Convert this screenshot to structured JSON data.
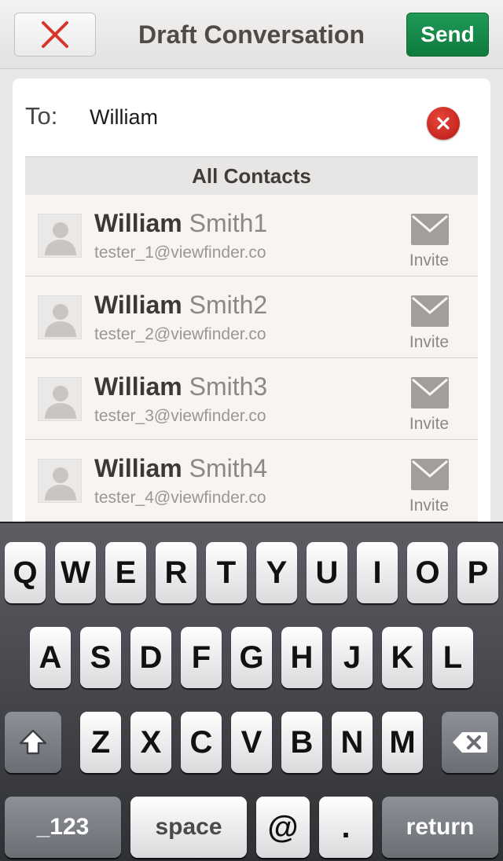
{
  "header": {
    "close_icon": "close-x-icon",
    "title": "Draft Conversation",
    "send_label": "Send"
  },
  "to_field": {
    "label": "To:",
    "value": "William",
    "clear_icon": "clear-circle-icon"
  },
  "section": {
    "title": "All Contacts"
  },
  "contacts": [
    {
      "first": "William",
      "last": "Smith1",
      "email": "tester_1@viewfinder.co",
      "action": "Invite"
    },
    {
      "first": "William",
      "last": "Smith2",
      "email": "tester_2@viewfinder.co",
      "action": "Invite"
    },
    {
      "first": "William",
      "last": "Smith3",
      "email": "tester_3@viewfinder.co",
      "action": "Invite"
    },
    {
      "first": "William",
      "last": "Smith4",
      "email": "tester_4@viewfinder.co",
      "action": "Invite"
    }
  ],
  "keyboard": {
    "row1": [
      "Q",
      "W",
      "E",
      "R",
      "T",
      "Y",
      "U",
      "I",
      "O",
      "P"
    ],
    "row2": [
      "A",
      "S",
      "D",
      "F",
      "G",
      "H",
      "J",
      "K",
      "L"
    ],
    "row3": [
      "Z",
      "X",
      "C",
      "V",
      "B",
      "N",
      "M"
    ],
    "shift_icon": "shift-arrow-icon",
    "delete_icon": "backspace-icon",
    "numbers_label": "_123",
    "space_label": "space",
    "at_label": "@",
    "dot_label": ".",
    "return_label": "return"
  },
  "colors": {
    "send_green": "#11803f",
    "close_red": "#d8352b",
    "clear_red": "#c92a22"
  }
}
